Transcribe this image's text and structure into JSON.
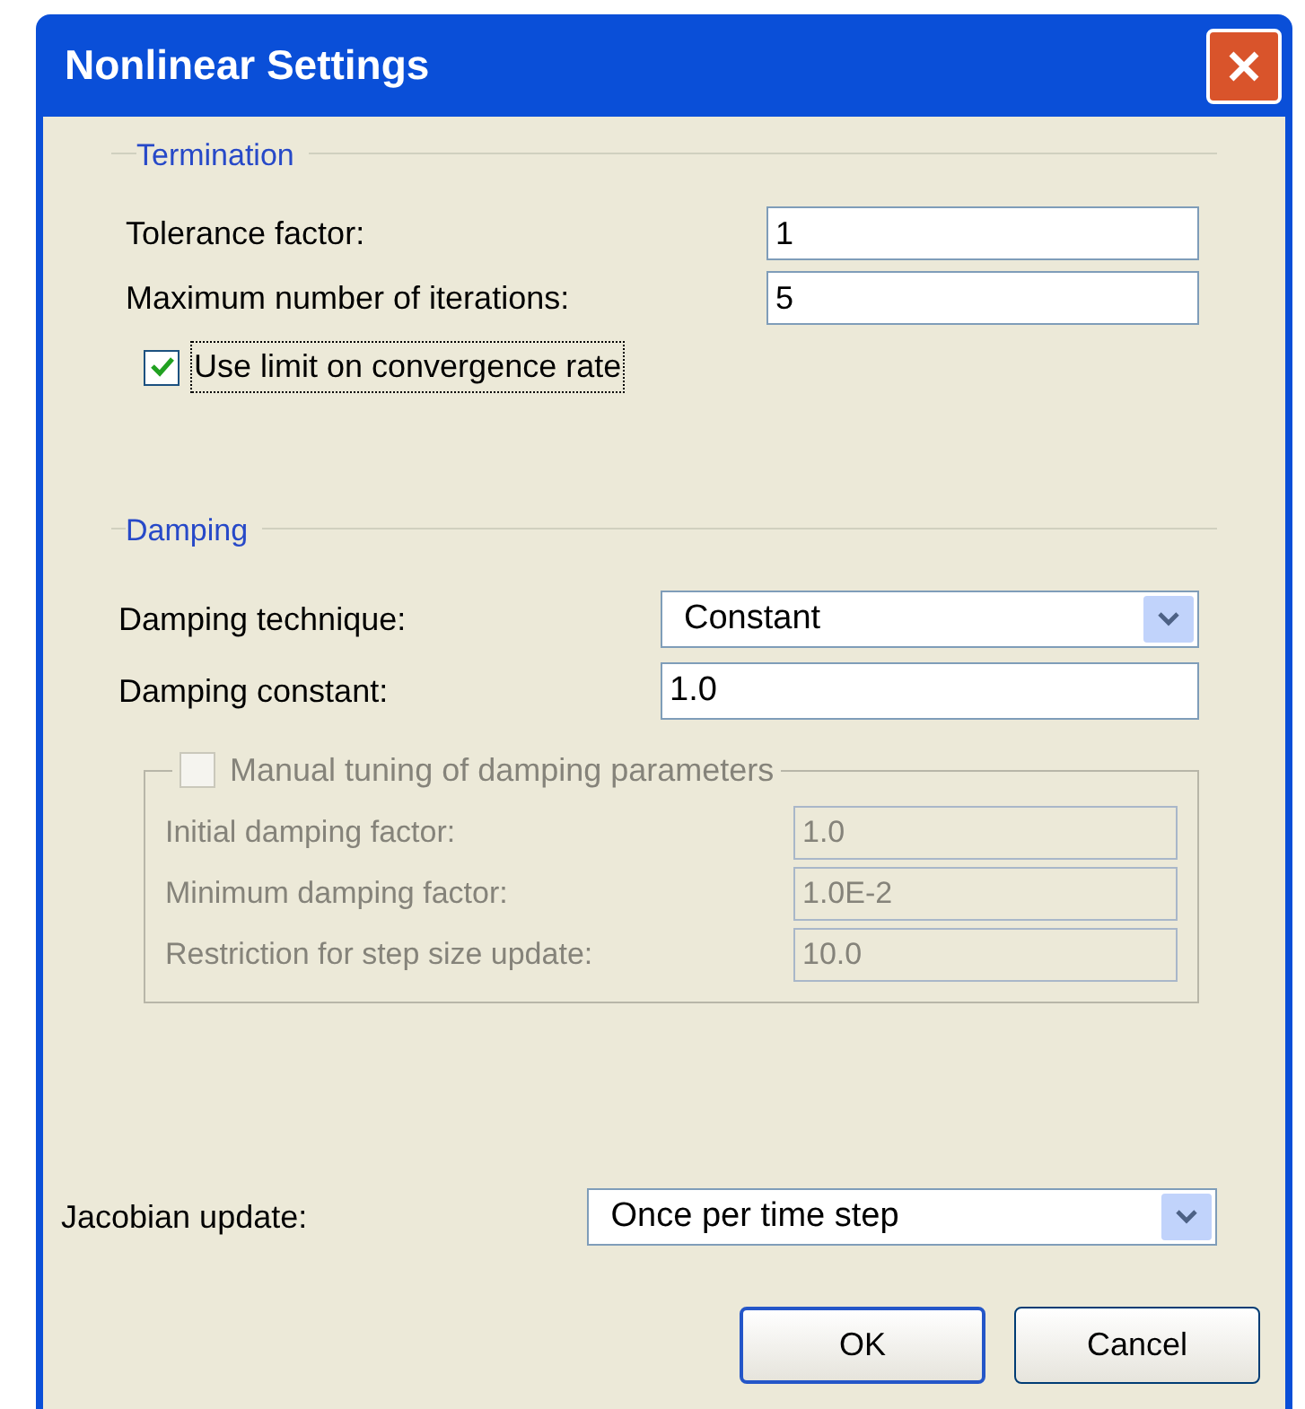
{
  "window": {
    "title": "Nonlinear Settings"
  },
  "termination": {
    "title": "Termination",
    "fields": [
      {
        "label": "Tolerance factor:",
        "value": "1"
      },
      {
        "label": "Maximum number of iterations:",
        "value": "5"
      }
    ],
    "checkbox": {
      "label": "Use limit on convergence rate",
      "checked": true,
      "focused": true
    }
  },
  "damping": {
    "title": "Damping",
    "technique": {
      "label": "Damping technique:",
      "value": "Constant"
    },
    "constant": {
      "label": "Damping constant:",
      "value": "1.0"
    },
    "manual": {
      "label": "Manual tuning of damping parameters",
      "checked": false,
      "disabled": true,
      "fields": [
        {
          "label": "Initial damping factor:",
          "value": "1.0"
        },
        {
          "label": "Minimum damping factor:",
          "value": "1.0E-2"
        },
        {
          "label": "Restriction for step size update:",
          "value": "10.0"
        }
      ]
    }
  },
  "jacobian": {
    "label": "Jacobian update:",
    "value": "Once per time step"
  },
  "buttons": [
    {
      "label": "OK",
      "default": true
    },
    {
      "label": "Cancel",
      "default": false
    }
  ]
}
